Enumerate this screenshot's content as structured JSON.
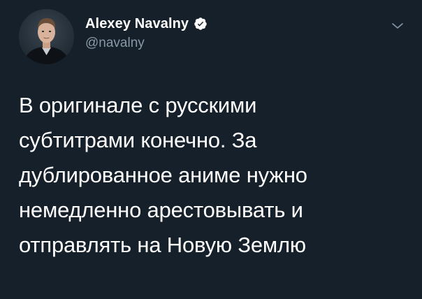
{
  "colors": {
    "background": "#15202b",
    "text_primary": "#ffffff",
    "text_secondary": "#8899a6",
    "verified_badge": "#ffffff"
  },
  "author": {
    "display_name": "Alexey Navalny",
    "handle": "@navalny",
    "verified": true,
    "avatar_icon": "profile-photo"
  },
  "tweet": {
    "lines": [
      "В оригинале с русскими",
      "субтитрами конечно. За",
      "дублированное аниме нужно",
      "немедленно арестовывать и",
      "отправлять на Новую Землю"
    ]
  },
  "menu": {
    "icon": "chevron-down-icon"
  }
}
